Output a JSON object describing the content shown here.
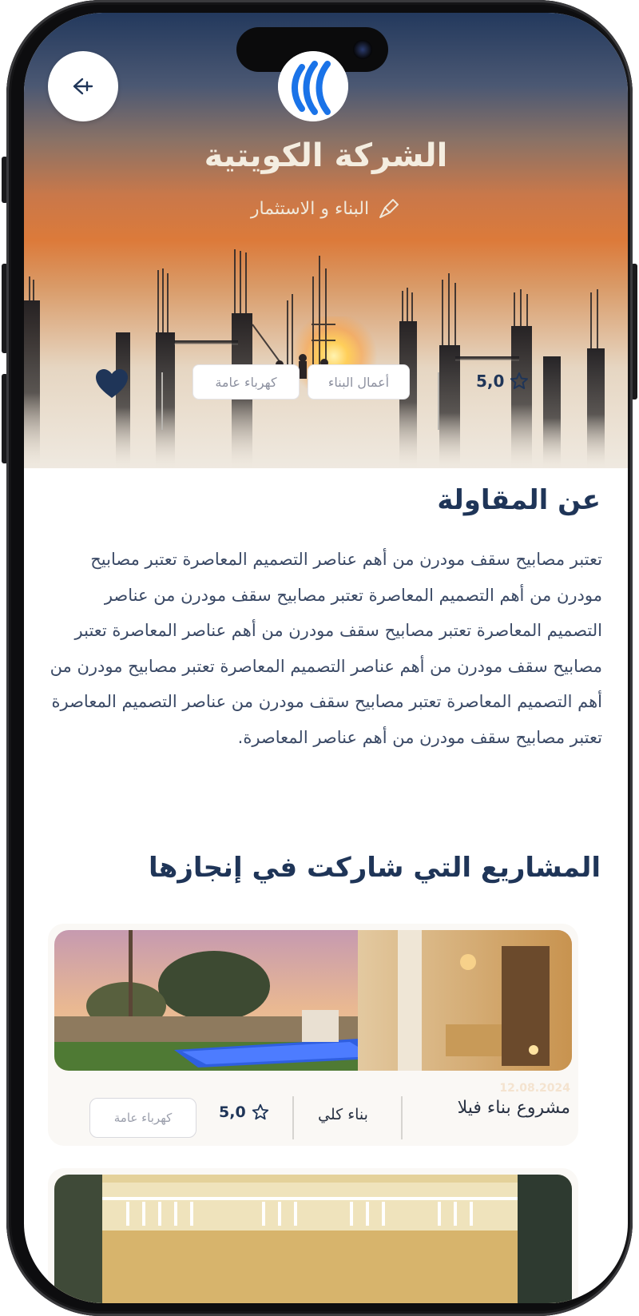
{
  "header": {
    "company_name": "الشركة الكويتية",
    "company_field": "البناء و الاستثمار",
    "rating": "5,0",
    "tags": [
      "أعمال البناء",
      "كهرباء عامة"
    ]
  },
  "about": {
    "title": "عن المقاولة",
    "text": "تعتبر مصابيح سقف مودرن من أهم عناصر التصميم المعاصرة تعتبر مصابيح  مودرن من أهم  التصميم المعاصرة تعتبر مصابيح سقف مودرن من  عناصر التصميم المعاصرة تعتبر مصابيح سقف مودرن من أهم عناصر  المعاصرة تعتبر مصابيح سقف مودرن من أهم عناصر التصميم المعاصرة تعتبر مصابيح  مودرن من أهم التصميم المعاصرة تعتبر مصابيح سقف مودرن من  عناصر التصميم المعاصرة تعتبر مصابيح سقف مودرن من أهم عناصر المعاصرة."
  },
  "projects": {
    "title": "المشاريع التي شاركت في إنجازها",
    "items": [
      {
        "date": "12.08.2024",
        "title": "مشروع بناء فيلا",
        "type": "بناء كلي",
        "rating": "5,0",
        "tag": "كهرباء عامة"
      }
    ]
  },
  "colors": {
    "primary": "#1f3558",
    "text": "#3b4a66",
    "tag_text": "#8d91a0"
  },
  "icons": {
    "back": "arrow-left-icon",
    "logo": "company-logo",
    "field": "trowel-icon",
    "favorite": "heart-icon",
    "rating": "star-icon"
  }
}
